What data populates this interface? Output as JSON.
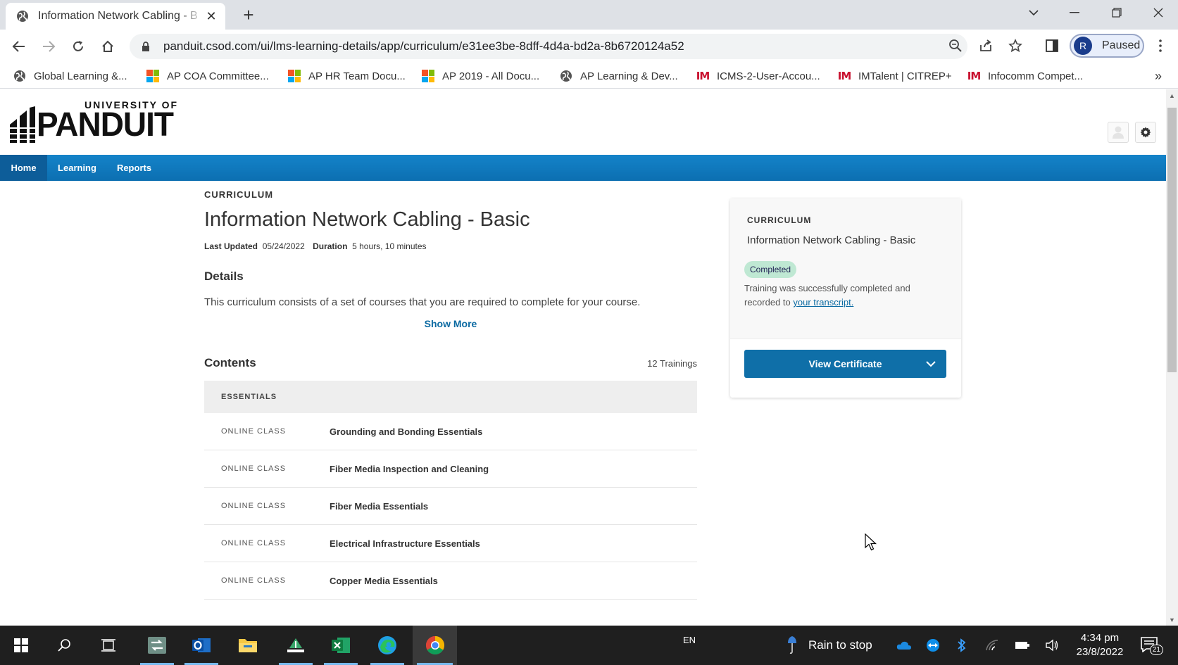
{
  "browser": {
    "tab_title": "Information Network Cabling - B",
    "url": "panduit.csod.com/ui/lms-learning-details/app/curriculum/e31ee3be-8dff-4d4a-bd2a-8b6720124a52",
    "profile_initial": "R",
    "profile_status": "Paused",
    "bookmarks": [
      {
        "label": "Global Learning &...",
        "icon": "globe-icon"
      },
      {
        "label": "AP COA Committee...",
        "icon": "microsoft-icon"
      },
      {
        "label": "AP HR Team Docu...",
        "icon": "microsoft-icon"
      },
      {
        "label": "AP 2019 - All Docu...",
        "icon": "microsoft-icon"
      },
      {
        "label": "AP Learning & Dev...",
        "icon": "globe-icon"
      },
      {
        "label": "ICMS-2-User-Accou...",
        "icon": "ims-icon"
      },
      {
        "label": "IMTalent | CITREP+",
        "icon": "ims-icon"
      },
      {
        "label": "Infocomm Compet...",
        "icon": "ims-icon"
      }
    ],
    "ims_glyph": "IM"
  },
  "site": {
    "logo_top": "UNIVERSITY OF",
    "logo_main": "PANDUIT",
    "nav": [
      "Home",
      "Learning",
      "Reports"
    ]
  },
  "curriculum": {
    "eyebrow": "CURRICULUM",
    "title": "Information Network Cabling - Basic",
    "last_updated_label": "Last Updated",
    "last_updated": "05/24/2022",
    "duration_label": "Duration",
    "duration": "5 hours, 10 minutes",
    "details_heading": "Details",
    "description": "This curriculum consists of a set of courses that you are required to complete for your course.",
    "show_more": "Show More",
    "contents_heading": "Contents",
    "trainings_count": "12 Trainings",
    "section_label": "ESSENTIALS",
    "rows": [
      {
        "type": "ONLINE CLASS",
        "name": "Grounding and Bonding Essentials"
      },
      {
        "type": "ONLINE CLASS",
        "name": "Fiber Media Inspection and Cleaning"
      },
      {
        "type": "ONLINE CLASS",
        "name": "Fiber Media Essentials"
      },
      {
        "type": "ONLINE CLASS",
        "name": "Electrical Infrastructure Essentials"
      },
      {
        "type": "ONLINE CLASS",
        "name": "Copper Media Essentials"
      }
    ]
  },
  "card": {
    "eyebrow": "CURRICULUM",
    "title": "Information Network Cabling - Basic",
    "status": "Completed",
    "message": "Training was successfully completed and recorded to",
    "link": "your transcript.",
    "button": "View Certificate"
  },
  "taskbar": {
    "language": "EN",
    "weather": "Rain to stop",
    "time": "4:34 pm",
    "date": "23/8/2022",
    "notifications": "21"
  },
  "colors": {
    "nav_blue": "#1483c9",
    "button_blue": "#0f6fa8",
    "link_blue": "#0b6aa2",
    "badge_green": "#bfe8d3"
  }
}
